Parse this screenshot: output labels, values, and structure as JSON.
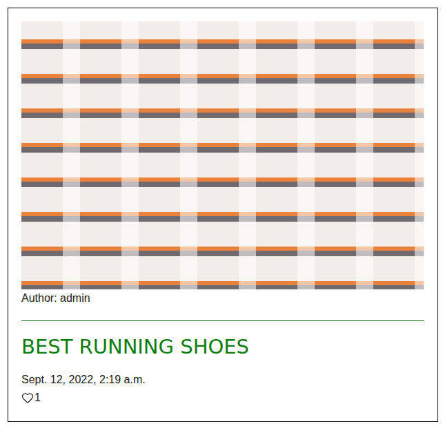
{
  "post": {
    "author": "Author: admin",
    "title": "BEST RUNNING SHOES",
    "date": "Sept. 12, 2022, 2:19 a.m.",
    "likes": "1",
    "liked": false
  }
}
